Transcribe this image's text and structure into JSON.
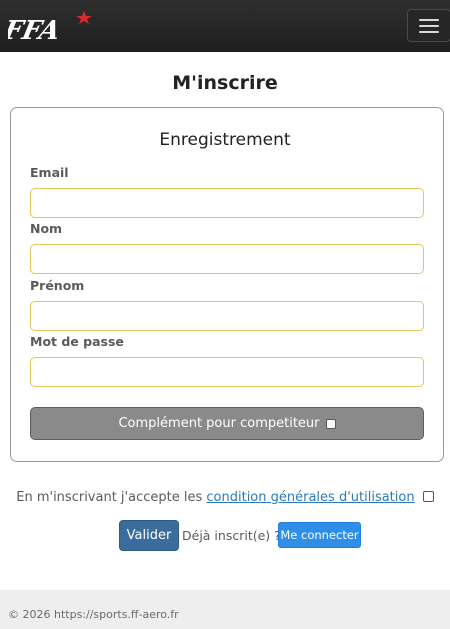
{
  "brand": {
    "logo_text": "FFA",
    "accent_color": "#e0262d"
  },
  "nav": {
    "toggle_icon": "hamburger-menu-icon"
  },
  "page": {
    "title": "M'inscrire"
  },
  "form": {
    "title": "Enregistrement",
    "fields": [
      {
        "label": "Email",
        "value": "",
        "placeholder": ""
      },
      {
        "label": "Nom",
        "value": "",
        "placeholder": ""
      },
      {
        "label": "Prénom",
        "value": "",
        "placeholder": ""
      },
      {
        "label": "Mot de passe",
        "value": "",
        "placeholder": ""
      }
    ],
    "competitor_toggle_label": "Complément pour competiteur",
    "competitor_checked": false,
    "input_border_color": "#e6c55a"
  },
  "terms": {
    "prefix": "En m'inscrivant j'accepte les",
    "link_text": "condition générales d'utilisation",
    "checked": false
  },
  "actions": {
    "submit_label": "Valider",
    "already_registered": "Déjà inscrit(e) ? :",
    "login_label": "Me connecter"
  },
  "footer": {
    "text": "© 2026 https://sports.ff-aero.fr"
  }
}
